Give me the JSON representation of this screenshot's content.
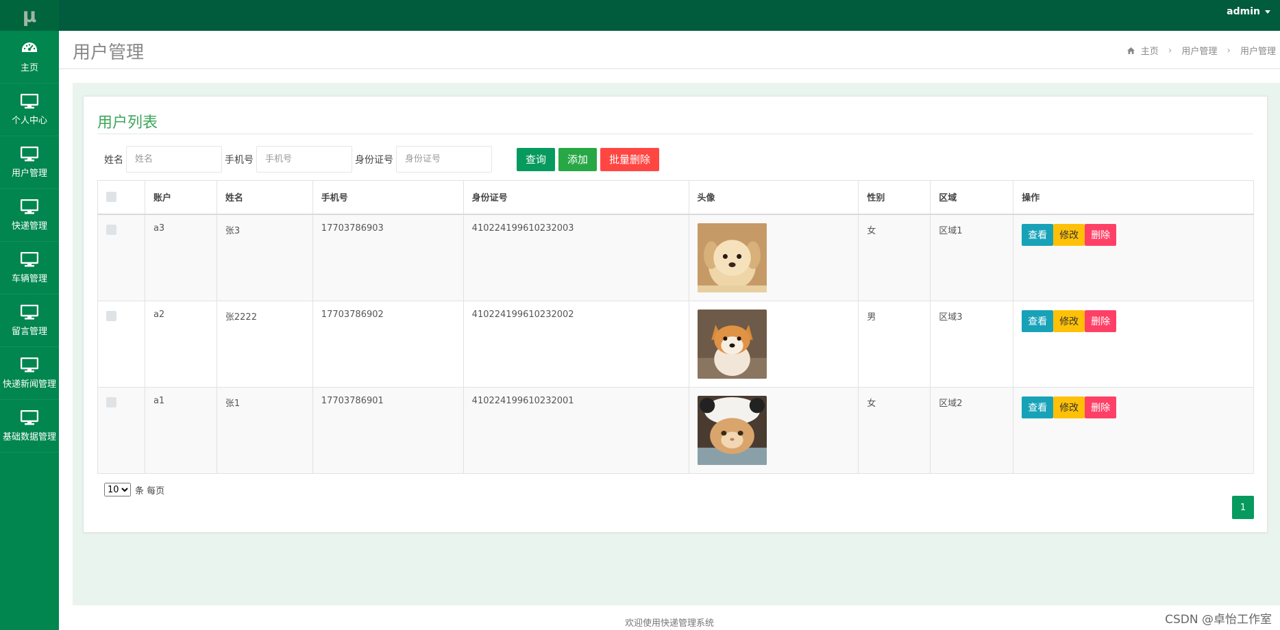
{
  "app": {
    "logo": "μ"
  },
  "sidebar": {
    "items": [
      {
        "label": "主页",
        "icon": "dashboard-icon"
      },
      {
        "label": "个人中心",
        "icon": "monitor-icon"
      },
      {
        "label": "用户管理",
        "icon": "monitor-icon"
      },
      {
        "label": "快递管理",
        "icon": "monitor-icon"
      },
      {
        "label": "车辆管理",
        "icon": "monitor-icon"
      },
      {
        "label": "留言管理",
        "icon": "monitor-icon"
      },
      {
        "label": "快递新闻管理",
        "icon": "monitor-icon"
      },
      {
        "label": "基础数据管理",
        "icon": "monitor-icon"
      }
    ]
  },
  "topbar": {
    "user": "admin"
  },
  "header": {
    "title": "用户管理",
    "breadcrumb": [
      "主页",
      "用户管理",
      "用户管理"
    ]
  },
  "panel": {
    "title": "用户列表"
  },
  "search": {
    "name_label": "姓名",
    "name_placeholder": "姓名",
    "phone_label": "手机号",
    "phone_placeholder": "手机号",
    "id_label": "身份证号",
    "id_placeholder": "身份证号",
    "query_btn": "查询",
    "add_btn": "添加",
    "batch_delete_btn": "批量删除"
  },
  "table": {
    "headers": [
      "账户",
      "姓名",
      "手机号",
      "身份证号",
      "头像",
      "性别",
      "区域",
      "操作"
    ],
    "rows": [
      {
        "account": "a3",
        "name": "张3",
        "phone": "17703786903",
        "id_card": "410224199610232003",
        "avatar": "puppy-photo",
        "gender": "女",
        "area": "区域1"
      },
      {
        "account": "a2",
        "name": "张2222",
        "phone": "17703786902",
        "id_card": "410224199610232002",
        "avatar": "shiba-photo",
        "gender": "男",
        "area": "区域3"
      },
      {
        "account": "a1",
        "name": "张1",
        "phone": "17703786901",
        "id_card": "410224199610232001",
        "avatar": "cat-photo",
        "gender": "女",
        "area": "区域2"
      }
    ],
    "actions": {
      "view": "查看",
      "edit": "修改",
      "delete": "删除"
    }
  },
  "pager": {
    "page_size": "10",
    "per_page_text": "条 每页",
    "current_page": "1"
  },
  "footer": {
    "text": "欢迎使用快递管理系统"
  },
  "watermark": "CSDN @卓怡工作室",
  "colors": {
    "sidebar": "#00864e",
    "topbar": "#005c3c",
    "accent": "#079a5f",
    "title_green": "#3aa65a"
  }
}
